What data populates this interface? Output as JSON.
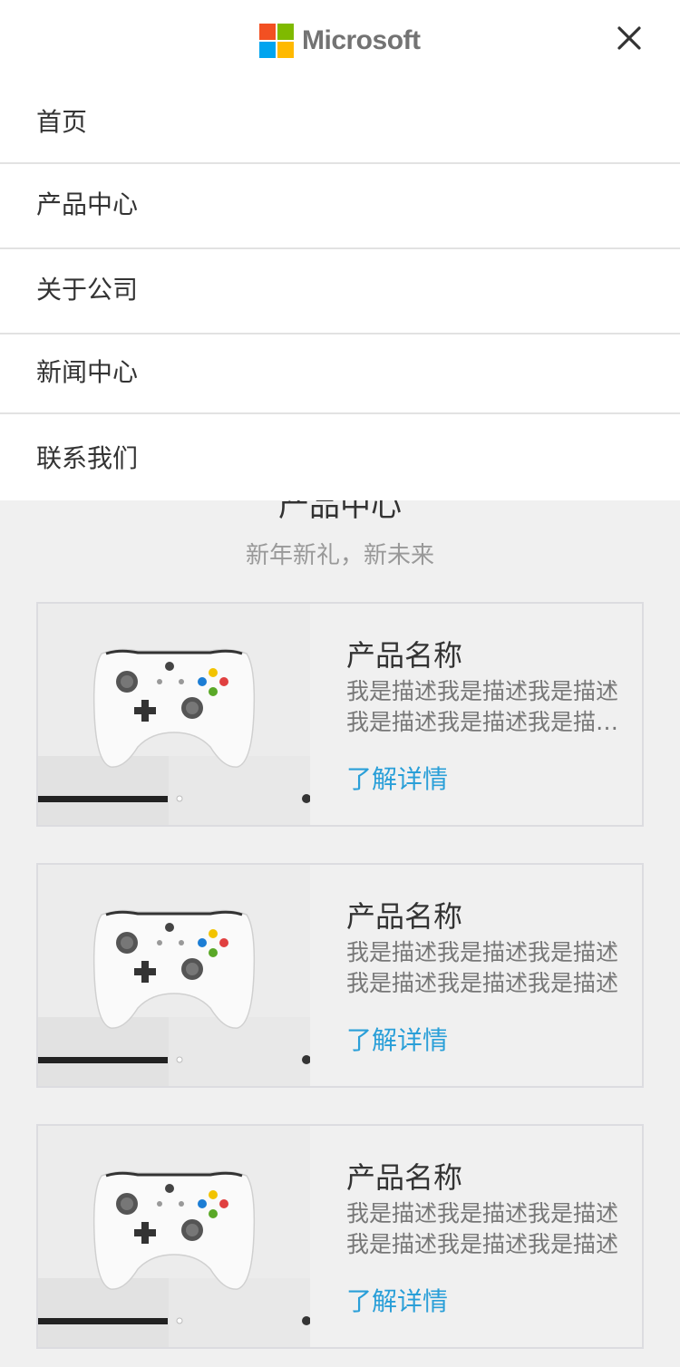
{
  "header": {
    "brand_name": "Microsoft",
    "brand_colors": [
      "#f25022",
      "#7fba00",
      "#00a4ef",
      "#ffb900"
    ],
    "close_icon": "close-icon"
  },
  "menu": {
    "items": [
      {
        "label": "首页"
      },
      {
        "label": "产品中心"
      },
      {
        "label": "关于公司"
      },
      {
        "label": "新闻中心"
      },
      {
        "label": "联系我们"
      }
    ]
  },
  "section": {
    "title": "产品中心",
    "subtitle": "新年新礼，新未来"
  },
  "products": [
    {
      "name": "产品名称",
      "desc_line1": "我是描述我是描述我是描述",
      "desc_line2": "我是描述我是描述我是描述我是描述",
      "link": "了解详情",
      "image": "xbox-controller-image"
    },
    {
      "name": "产品名称",
      "desc_line1": "我是描述我是描述我是描述",
      "desc_line2": "我是描述我是描述我是描述",
      "link": "了解详情",
      "image": "xbox-controller-image"
    },
    {
      "name": "产品名称",
      "desc_line1": "我是描述我是描述我是描述",
      "desc_line2": "我是描述我是描述我是描述",
      "link": "了解详情",
      "image": "xbox-controller-image"
    }
  ],
  "colors": {
    "link": "#2a9fd8",
    "page_bg": "#f0f0f0"
  }
}
